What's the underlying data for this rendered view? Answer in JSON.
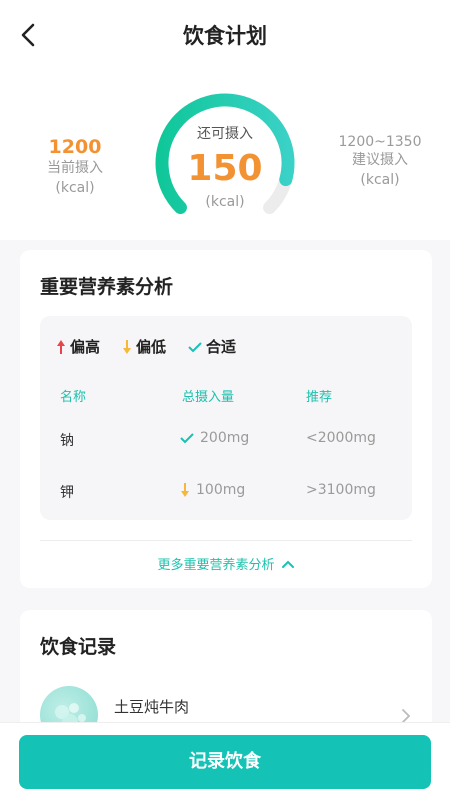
{
  "header": {
    "title": "饮食计划"
  },
  "calorie": {
    "current_value": "1200",
    "current_label": "当前摄入",
    "current_unit": "(kcal)",
    "remaining_label": "还可摄入",
    "remaining_value": "150",
    "remaining_unit": "(kcal)",
    "recommended_range": "1200~1350",
    "recommended_label": "建议摄入",
    "recommended_unit": "(kcal)",
    "gauge_fill_fraction": 0.89,
    "colors": {
      "accent": "#14c3b6",
      "orange": "#f39233",
      "track": "#e9e9e9"
    }
  },
  "nutrition": {
    "title": "重要营养素分析",
    "legend": {
      "high": "偏高",
      "low": "偏低",
      "ok": "合适"
    },
    "columns": {
      "name": "名称",
      "total": "总摄入量",
      "recommended": "推荐"
    },
    "rows": [
      {
        "name": "钠",
        "status": "ok",
        "value": "200mg",
        "recommended": "<2000mg"
      },
      {
        "name": "钾",
        "status": "low",
        "value": "100mg",
        "recommended": ">3100mg"
      }
    ],
    "more_link": "更多重要营养素分析"
  },
  "diet_record": {
    "title": "饮食记录",
    "items": [
      {
        "name": "土豆炖牛肉"
      }
    ]
  },
  "footer": {
    "record_button": "记录饮食"
  }
}
